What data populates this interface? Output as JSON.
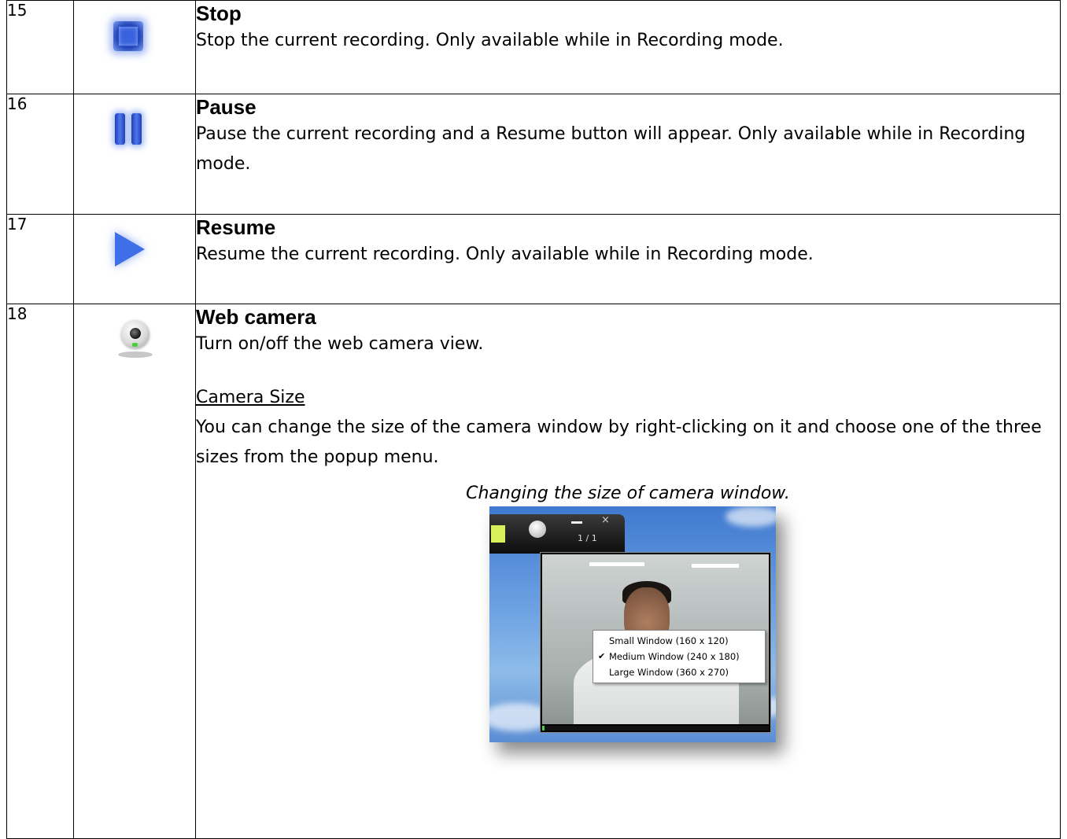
{
  "rows": [
    {
      "number": "15",
      "icon": "stop-icon",
      "title": "Stop",
      "text": "Stop the current recording. Only available while in Recording mode."
    },
    {
      "number": "16",
      "icon": "pause-icon",
      "title": "Pause",
      "text": "Pause the current recording and a Resume button will appear. Only available while in Recording mode."
    },
    {
      "number": "17",
      "icon": "resume-icon",
      "title": "Resume",
      "text": "Resume the current recording. Only available while in Recording mode."
    },
    {
      "number": "18",
      "icon": "webcam-icon",
      "title": "Web camera",
      "text": "Turn on/off the web camera view.",
      "subheading": "Camera Size",
      "subtext": "You can change the size of the camera window by right-clicking on it and choose one of the three sizes from the popup menu.",
      "caption": "Changing the size of camera window.",
      "figure": {
        "page_indicator": "1 / 1",
        "menu_items": [
          {
            "label": "Small Window (160 x 120)",
            "checked": false
          },
          {
            "label": "Medium Window (240 x 180)",
            "checked": true
          },
          {
            "label": "Large Window (360 x 270)",
            "checked": false
          }
        ],
        "check_mark": "✔"
      }
    }
  ],
  "colors": {
    "icon_blue": "#3f6fe8",
    "sky_blue": "#6ea3e3",
    "led_green": "#47d13a"
  }
}
